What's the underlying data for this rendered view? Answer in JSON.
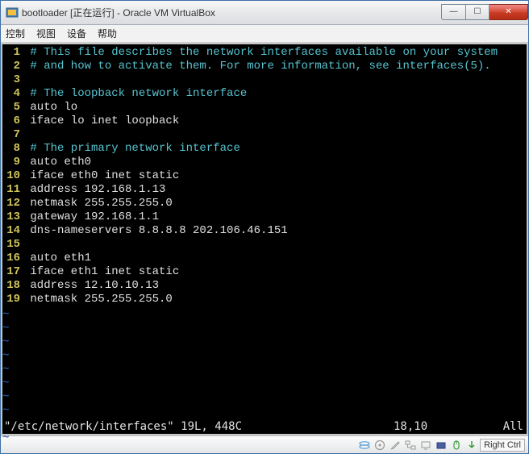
{
  "title": "bootloader [正在运行] - Oracle VM VirtualBox",
  "menus": {
    "m0": "控制",
    "m1": "视图",
    "m2": "设备",
    "m3": "帮助"
  },
  "lines": [
    {
      "n": "1",
      "t": " # This file describes the network interfaces available on your system",
      "c": true
    },
    {
      "n": "2",
      "t": " # and how to activate them. For more information, see interfaces(5).",
      "c": true
    },
    {
      "n": "3",
      "t": "",
      "c": false
    },
    {
      "n": "4",
      "t": " # The loopback network interface",
      "c": true
    },
    {
      "n": "5",
      "t": " auto lo",
      "c": false
    },
    {
      "n": "6",
      "t": " iface lo inet loopback",
      "c": false
    },
    {
      "n": "7",
      "t": "",
      "c": false
    },
    {
      "n": "8",
      "t": " # The primary network interface",
      "c": true
    },
    {
      "n": "9",
      "t": " auto eth0",
      "c": false
    },
    {
      "n": "10",
      "t": " iface eth0 inet static",
      "c": false
    },
    {
      "n": "11",
      "t": " address 192.168.1.13",
      "c": false
    },
    {
      "n": "12",
      "t": " netmask 255.255.255.0",
      "c": false
    },
    {
      "n": "13",
      "t": " gateway 192.168.1.1",
      "c": false
    },
    {
      "n": "14",
      "t": " dns-nameservers 8.8.8.8 202.106.46.151",
      "c": false
    },
    {
      "n": "15",
      "t": "",
      "c": false
    },
    {
      "n": "16",
      "t": " auto eth1",
      "c": false
    },
    {
      "n": "17",
      "t": " iface eth1 inet static",
      "c": false
    },
    {
      "n": "18",
      "t": " address 12.10.10.13",
      "c": false
    },
    {
      "n": "19",
      "t": " netmask 255.255.255.0",
      "c": false
    }
  ],
  "vim_status": {
    "file": "\"/etc/network/interfaces\" 19L, 448C",
    "pos": "18,10",
    "pct": "All"
  },
  "hostkey": "Right Ctrl",
  "win_controls": {
    "min": "—",
    "max": "☐",
    "close": "✕"
  },
  "sb_icons": {
    "i0": "disk-icon",
    "i1": "optical-icon",
    "i2": "pen-icon",
    "i3": "network-icon",
    "i4": "display-icon",
    "i5": "shared-icon",
    "i6": "mouse-icon",
    "i7": "arrow-icon"
  }
}
